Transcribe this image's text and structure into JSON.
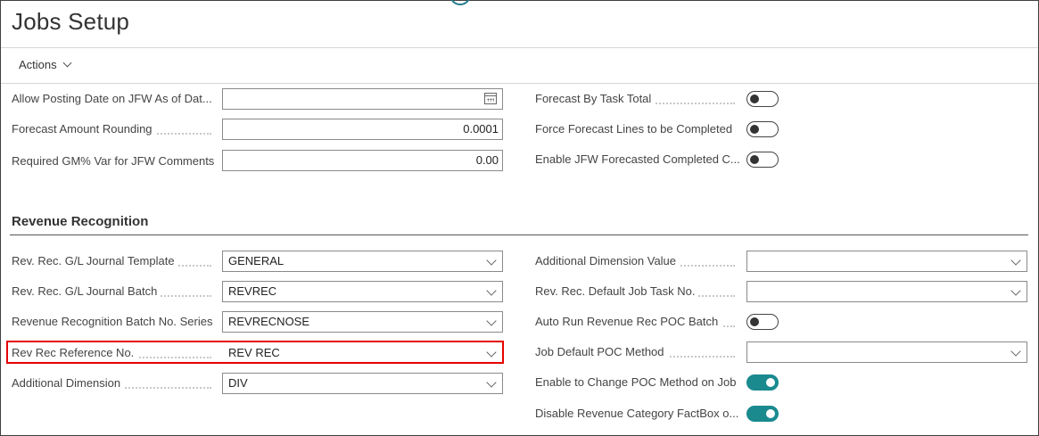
{
  "page": {
    "title": "Jobs Setup",
    "actions_label": "Actions"
  },
  "general": {
    "left": [
      {
        "label": "Allow Posting Date on JFW As of Dat...",
        "value": "",
        "kind": "date"
      },
      {
        "label": "Forecast Amount Rounding",
        "value": "0.0001",
        "kind": "number"
      },
      {
        "label": "Required GM% Var for JFW Comments",
        "value": "0.00",
        "kind": "number"
      }
    ],
    "right": [
      {
        "label": "Forecast By Task Total",
        "on": false
      },
      {
        "label": "Force Forecast Lines to be Completed",
        "on": false
      },
      {
        "label": "Enable JFW Forecasted Completed C...",
        "on": false
      }
    ]
  },
  "revenue": {
    "title": "Revenue Recognition",
    "left": [
      {
        "label": "Rev. Rec. G/L Journal Template",
        "value": "GENERAL"
      },
      {
        "label": "Rev. Rec. G/L Journal Batch",
        "value": "REVREC"
      },
      {
        "label": "Revenue Recognition Batch No. Series",
        "value": "REVRECNOSE"
      },
      {
        "label": "Rev Rec Reference No.",
        "value": "REV REC"
      },
      {
        "label": "Additional Dimension",
        "value": "DIV"
      }
    ],
    "right": [
      {
        "label": "Additional Dimension Value",
        "kind": "select",
        "value": ""
      },
      {
        "label": "Rev. Rec. Default Job Task No.",
        "kind": "select",
        "value": ""
      },
      {
        "label": "Auto Run Revenue Rec POC Batch",
        "kind": "toggle",
        "on": false
      },
      {
        "label": "Job Default POC Method",
        "kind": "select",
        "value": ""
      },
      {
        "label": "Enable to Change POC Method on Job",
        "kind": "toggle",
        "on": true
      },
      {
        "label": "Disable Revenue Category FactBox o...",
        "kind": "toggle",
        "on": true
      }
    ]
  },
  "colors": {
    "toggle_on": "#1a8a8f",
    "highlight": "#e60000"
  },
  "icons": {
    "date": "calendar-icon",
    "select": "chevron-down-icon",
    "actions": "chevron-down-icon"
  }
}
